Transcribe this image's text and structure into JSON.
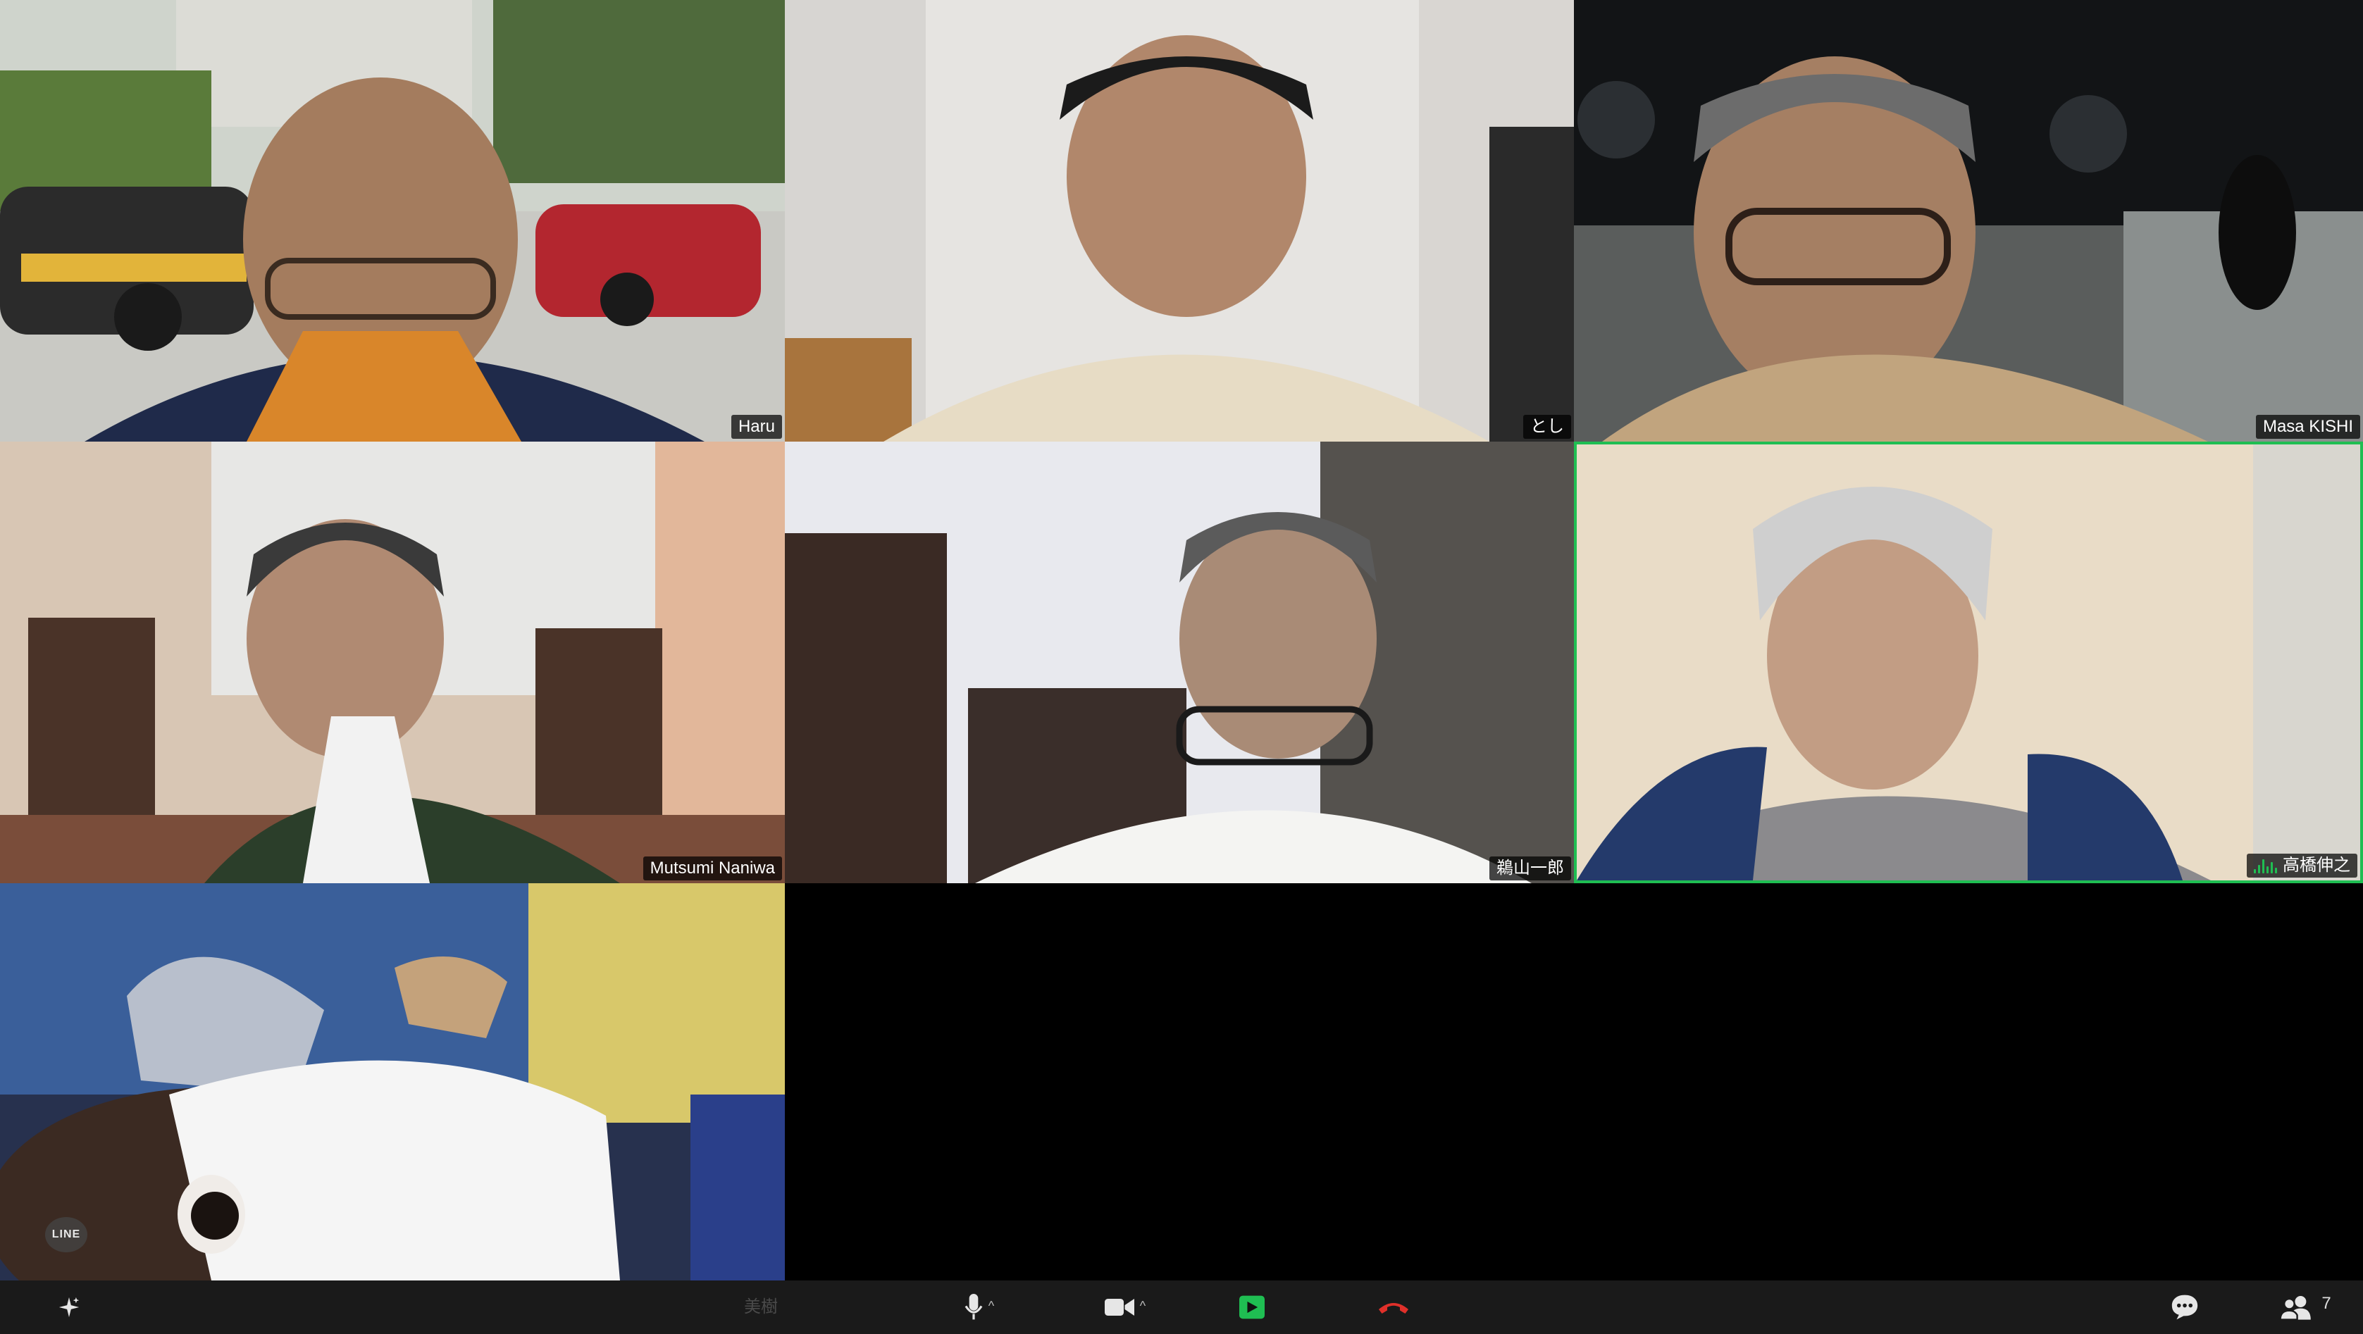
{
  "tiles": [
    {
      "name": "Haru"
    },
    {
      "name": "とし"
    },
    {
      "name": "Masa KISHI"
    },
    {
      "name": "Mutsumi Naniwa"
    },
    {
      "name": "鵜山一郎"
    },
    {
      "name": "高橋伸之",
      "active_speaker": true
    },
    {
      "name": "美樹",
      "overlay_badge": "LINE"
    }
  ],
  "toolbar": {
    "participant_count": "7",
    "icons": [
      "sparkle-icon",
      "microphone-icon",
      "video-camera-icon",
      "share-screen-icon",
      "end-call-icon",
      "chat-icon",
      "participants-icon"
    ]
  },
  "colors": {
    "speaking_border": "#1fbe52",
    "share_screen": "#1fbe52",
    "end_call": "#e0302a",
    "toolbar_bg": "#1a1a1a"
  }
}
